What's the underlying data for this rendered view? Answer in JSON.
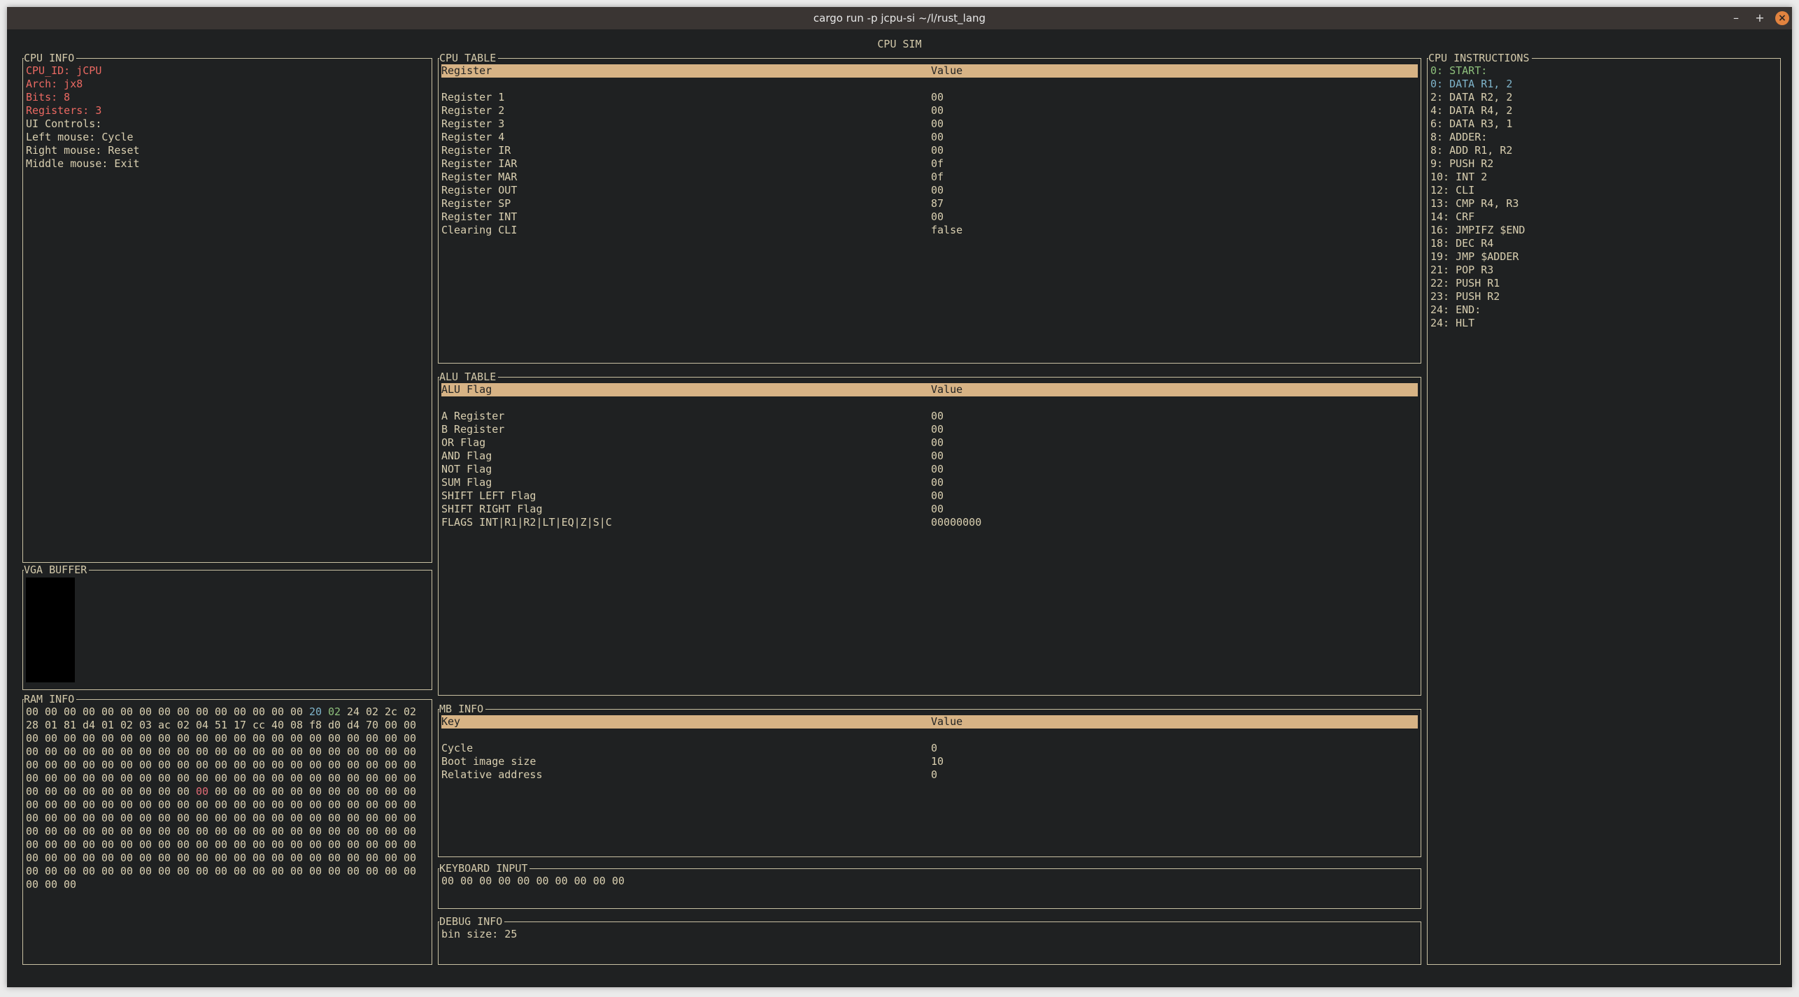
{
  "window": {
    "title": "cargo run -p jcpu-si ~/l/rust_lang",
    "controls": {
      "minimize": "–",
      "maximize": "+",
      "close": "×"
    }
  },
  "app": {
    "title": "CPU SIM"
  },
  "cpu_info": {
    "title": "CPU INFO",
    "lines": [
      {
        "text": "CPU_ID: jCPU",
        "style": "red"
      },
      {
        "text": "Arch: jx8",
        "style": "red"
      },
      {
        "text": "Bits: 8",
        "style": "red"
      },
      {
        "text": "Registers: 3",
        "style": "red"
      },
      {
        "text": "UI Controls:",
        "style": "plain"
      },
      {
        "text": "Left mouse: Cycle",
        "style": "plain"
      },
      {
        "text": "Right mouse: Reset",
        "style": "plain"
      },
      {
        "text": "Middle mouse: Exit",
        "style": "plain"
      }
    ]
  },
  "vga_buffer": {
    "title": "VGA BUFFER"
  },
  "ram_info": {
    "title": "RAM INFO",
    "rows": [
      [
        "00",
        "00",
        "00",
        "00",
        "00",
        "00",
        "00",
        "00",
        "00",
        "00",
        "00",
        "00",
        "00",
        "00",
        "00",
        "20",
        "02",
        "24",
        "02",
        "2c",
        "02"
      ],
      [
        "28",
        "01",
        "81",
        "d4",
        "01",
        "02",
        "03",
        "ac",
        "02",
        "04",
        "51",
        "17",
        "cc",
        "40",
        "08",
        "f8",
        "d0",
        "d4",
        "70",
        "00",
        "00"
      ],
      [
        "00",
        "00",
        "00",
        "00",
        "00",
        "00",
        "00",
        "00",
        "00",
        "00",
        "00",
        "00",
        "00",
        "00",
        "00",
        "00",
        "00",
        "00",
        "00",
        "00",
        "00"
      ],
      [
        "00",
        "00",
        "00",
        "00",
        "00",
        "00",
        "00",
        "00",
        "00",
        "00",
        "00",
        "00",
        "00",
        "00",
        "00",
        "00",
        "00",
        "00",
        "00",
        "00",
        "00"
      ],
      [
        "00",
        "00",
        "00",
        "00",
        "00",
        "00",
        "00",
        "00",
        "00",
        "00",
        "00",
        "00",
        "00",
        "00",
        "00",
        "00",
        "00",
        "00",
        "00",
        "00",
        "00"
      ],
      [
        "00",
        "00",
        "00",
        "00",
        "00",
        "00",
        "00",
        "00",
        "00",
        "00",
        "00",
        "00",
        "00",
        "00",
        "00",
        "00",
        "00",
        "00",
        "00",
        "00",
        "00"
      ],
      [
        "00",
        "00",
        "00",
        "00",
        "00",
        "00",
        "00",
        "00",
        "00",
        "00",
        "00",
        "00",
        "00",
        "00",
        "00",
        "00",
        "00",
        "00",
        "00",
        "00",
        "00"
      ],
      [
        "00",
        "00",
        "00",
        "00",
        "00",
        "00",
        "00",
        "00",
        "00",
        "00",
        "00",
        "00",
        "00",
        "00",
        "00",
        "00",
        "00",
        "00",
        "00",
        "00",
        "00"
      ],
      [
        "00",
        "00",
        "00",
        "00",
        "00",
        "00",
        "00",
        "00",
        "00",
        "00",
        "00",
        "00",
        "00",
        "00",
        "00",
        "00",
        "00",
        "00",
        "00",
        "00",
        "00"
      ],
      [
        "00",
        "00",
        "00",
        "00",
        "00",
        "00",
        "00",
        "00",
        "00",
        "00",
        "00",
        "00",
        "00",
        "00",
        "00",
        "00",
        "00",
        "00",
        "00",
        "00",
        "00"
      ],
      [
        "00",
        "00",
        "00",
        "00",
        "00",
        "00",
        "00",
        "00",
        "00",
        "00",
        "00",
        "00",
        "00",
        "00",
        "00",
        "00",
        "00",
        "00",
        "00",
        "00",
        "00"
      ],
      [
        "00",
        "00",
        "00",
        "00",
        "00",
        "00",
        "00",
        "00",
        "00",
        "00",
        "00",
        "00",
        "00",
        "00",
        "00",
        "00",
        "00",
        "00",
        "00",
        "00",
        "00"
      ],
      [
        "00",
        "00",
        "00",
        "00",
        "00",
        "00",
        "00",
        "00",
        "00",
        "00",
        "00",
        "00",
        "00",
        "00",
        "00",
        "00",
        "00",
        "00",
        "00",
        "00",
        "00"
      ],
      [
        "00",
        "00",
        "00"
      ]
    ],
    "highlights": [
      {
        "row": 0,
        "col": 15,
        "style": "cyan"
      },
      {
        "row": 0,
        "col": 16,
        "style": "teal"
      },
      {
        "row": 6,
        "col": 9,
        "style": "mag"
      }
    ]
  },
  "cpu_table": {
    "title": "CPU TABLE",
    "headers": [
      "Register",
      "Value"
    ],
    "rows": [
      [
        "Register 1",
        "00"
      ],
      [
        "Register 2",
        "00"
      ],
      [
        "Register 3",
        "00"
      ],
      [
        "Register 4",
        "00"
      ],
      [
        "Register IR",
        "00"
      ],
      [
        "Register IAR",
        "0f"
      ],
      [
        "Register MAR",
        "0f"
      ],
      [
        "Register OUT",
        "00"
      ],
      [
        "Register SP",
        "87"
      ],
      [
        "Register INT",
        "00"
      ],
      [
        "Clearing CLI",
        "false"
      ]
    ]
  },
  "alu_table": {
    "title": "ALU TABLE",
    "headers": [
      "ALU Flag",
      "Value"
    ],
    "rows": [
      [
        "A Register",
        "00"
      ],
      [
        "B Register",
        "00"
      ],
      [
        "OR Flag",
        "00"
      ],
      [
        "AND Flag",
        "00"
      ],
      [
        "NOT Flag",
        "00"
      ],
      [
        "SUM Flag",
        "00"
      ],
      [
        "SHIFT LEFT Flag",
        "00"
      ],
      [
        "SHIFT RIGHT Flag",
        "00"
      ],
      [
        "FLAGS INT|R1|R2|LT|EQ|Z|S|C",
        "00000000"
      ]
    ]
  },
  "mb_info": {
    "title": "MB INFO",
    "headers": [
      "Key",
      "Value"
    ],
    "rows": [
      [
        "Cycle",
        "0"
      ],
      [
        "Boot image size",
        "10"
      ],
      [
        "Relative address",
        "0"
      ]
    ]
  },
  "keyboard_input": {
    "title": "KEYBOARD INPUT",
    "value": "00 00 00 00 00 00 00 00 00 00"
  },
  "debug_info": {
    "title": "DEBUG INFO",
    "value": "bin size: 25"
  },
  "cpu_instructions": {
    "title": "CPU INSTRUCTIONS",
    "lines": [
      {
        "text": "0: START:",
        "style": "teal"
      },
      {
        "text": "0: DATA R1, 2",
        "style": "cyan"
      },
      {
        "text": "2: DATA R2, 2",
        "style": "plain"
      },
      {
        "text": "4: DATA R4, 2",
        "style": "plain"
      },
      {
        "text": "6: DATA R3, 1",
        "style": "plain"
      },
      {
        "text": "8: ADDER:",
        "style": "plain"
      },
      {
        "text": "8: ADD R1, R2",
        "style": "plain"
      },
      {
        "text": "9: PUSH R2",
        "style": "plain"
      },
      {
        "text": "10: INT 2",
        "style": "plain"
      },
      {
        "text": "12: CLI",
        "style": "plain"
      },
      {
        "text": "13: CMP R4, R3",
        "style": "plain"
      },
      {
        "text": "14: CRF",
        "style": "plain"
      },
      {
        "text": "16: JMPIFZ $END",
        "style": "plain"
      },
      {
        "text": "18: DEC R4",
        "style": "plain"
      },
      {
        "text": "19: JMP $ADDER",
        "style": "plain"
      },
      {
        "text": "21: POP R3",
        "style": "plain"
      },
      {
        "text": "22: PUSH R1",
        "style": "plain"
      },
      {
        "text": "23: PUSH R2",
        "style": "plain"
      },
      {
        "text": "24: END:",
        "style": "plain"
      },
      {
        "text": "24: HLT",
        "style": "plain"
      }
    ]
  }
}
